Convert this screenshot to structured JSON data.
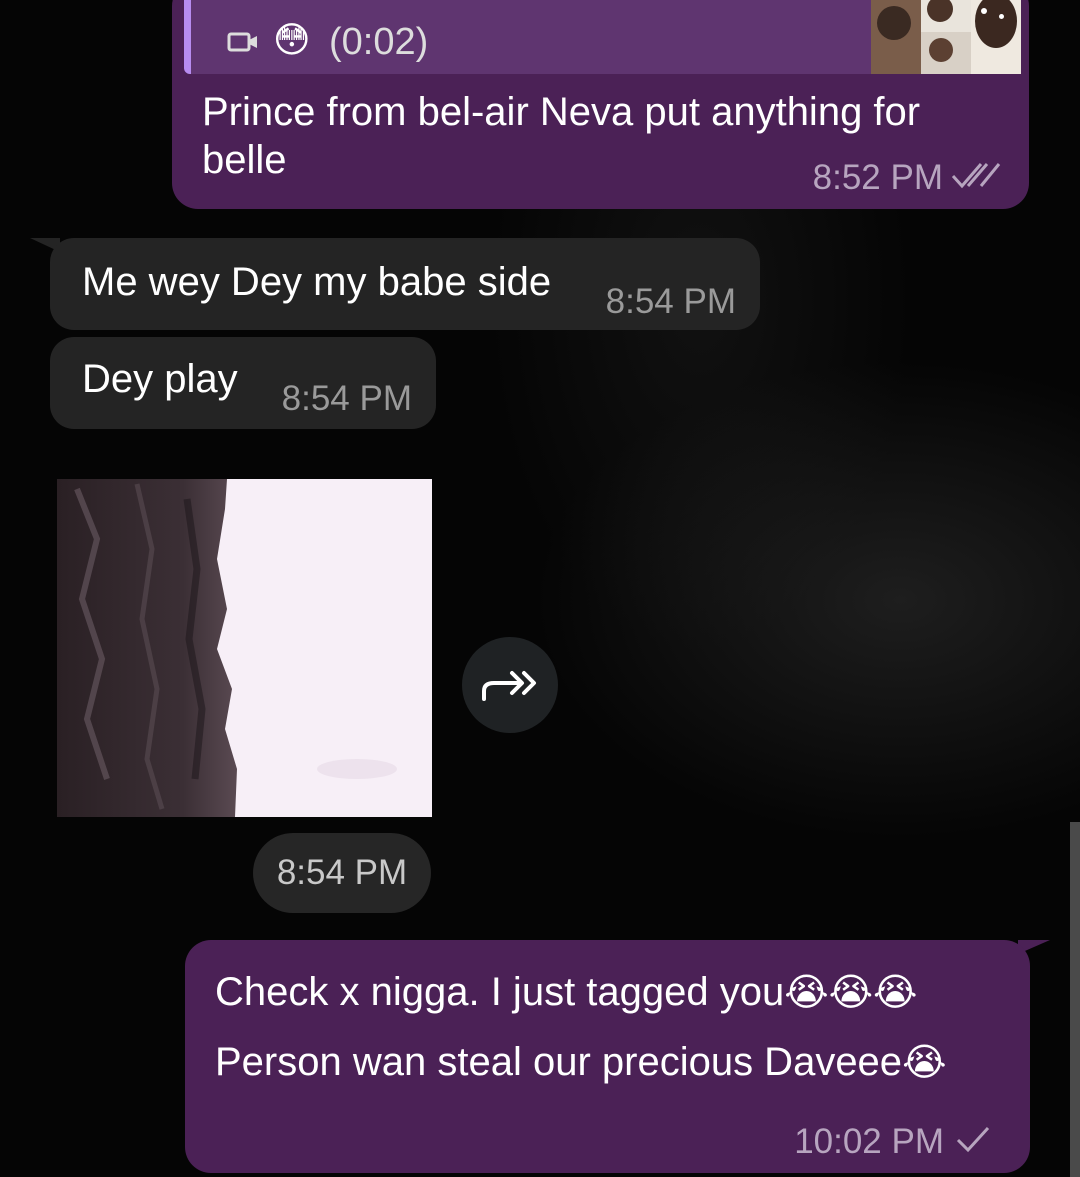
{
  "colors": {
    "outgoing_bubble": "#4b2156",
    "incoming_bubble": "#242424",
    "reply_accent": "#b78cf0"
  },
  "messages": {
    "top": {
      "reply": {
        "icon": "video-icon",
        "emoji": "😳",
        "duration": "(0:02)"
      },
      "text": "Prince from bel-air Neva put anything for belle",
      "time": "8:52 PM",
      "status_icon": "double-check-icon"
    },
    "incoming1": {
      "text": "Me wey Dey my babe side",
      "time": "8:54 PM"
    },
    "incoming2": {
      "text": "Dey play",
      "time": "8:54 PM"
    },
    "sticker": {
      "time": "8:54 PM",
      "forward_icon": "forward-arrow-icon"
    },
    "bottom": {
      "line1_text": "Check x nigga. I just tagged you",
      "line1_emoji": "😭😭😭",
      "line2_text": "Person wan steal our precious Daveee",
      "line2_emoji": "😭",
      "time": "10:02 PM",
      "status_icon": "single-check-icon"
    }
  }
}
